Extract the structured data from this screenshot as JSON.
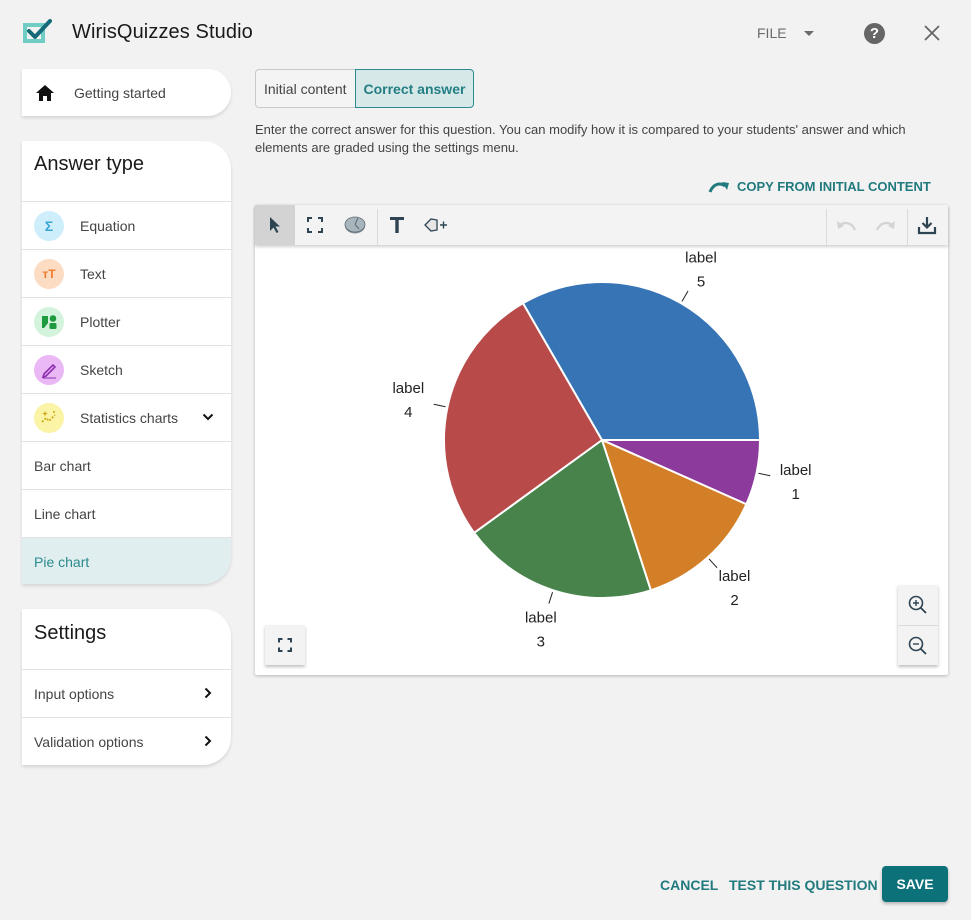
{
  "header": {
    "app_title": "WirisQuizzes Studio",
    "file_menu_label": "FILE",
    "help_icon": "question-circle-icon",
    "close_icon": "close-icon"
  },
  "sidebar": {
    "getting_started": {
      "label": "Getting started",
      "icon": "home-icon"
    },
    "answer_type": {
      "title": "Answer type",
      "items": [
        {
          "label": "Equation",
          "icon": "sigma-icon",
          "glyph": "Σ",
          "badge_bg": "#cdeefa",
          "badge_fg": "#3ba5d4"
        },
        {
          "label": "Text",
          "icon": "text-size-icon",
          "glyph": "тT",
          "badge_bg": "#fddcc4",
          "badge_fg": "#ee7b2a"
        },
        {
          "label": "Plotter",
          "icon": "shapes-icon",
          "glyph": "◆",
          "badge_bg": "#d4f3dc",
          "badge_fg": "#1f9a3f"
        },
        {
          "label": "Sketch",
          "icon": "pencil-icon",
          "glyph": "✎",
          "badge_bg": "#eab9f5",
          "badge_fg": "#8b2fb0"
        },
        {
          "label": "Statistics charts",
          "icon": "sparkle-chart-icon",
          "glyph": "✦",
          "badge_bg": "#fbf3a6",
          "badge_fg": "#c9a712",
          "expanded": true
        }
      ],
      "sub_items": [
        {
          "label": "Bar chart",
          "selected": false
        },
        {
          "label": "Line chart",
          "selected": false
        },
        {
          "label": "Pie chart",
          "selected": true
        }
      ]
    },
    "settings": {
      "title": "Settings",
      "items": [
        {
          "label": "Input options"
        },
        {
          "label": "Validation options"
        }
      ]
    }
  },
  "main": {
    "tabs": [
      {
        "label": "Initial content",
        "active": false
      },
      {
        "label": "Correct answer",
        "active": true
      }
    ],
    "description": "Enter the correct answer for this question. You can modify how it is compared to your students' answer and which elements are graded using the settings menu.",
    "copy_link": "COPY FROM INITIAL CONTENT",
    "toolbar": {
      "tools": [
        "select-arrow-icon",
        "selection-frame-icon",
        "pie-chart-icon",
        "text-tool-icon",
        "add-shape-icon"
      ],
      "right_tools": [
        "undo-icon",
        "redo-icon",
        "download-icon"
      ],
      "active_tool": "select-arrow-icon"
    }
  },
  "chart_data": {
    "type": "pie",
    "start_angle_deg": 0,
    "direction": "clockwise",
    "slices": [
      {
        "label": "label",
        "value": 1,
        "color": "#8c3b9c"
      },
      {
        "label": "label",
        "value": 2,
        "color": "#d27f27"
      },
      {
        "label": "label",
        "value": 3,
        "color": "#48834c"
      },
      {
        "label": "label",
        "value": 4,
        "color": "#b94a4a"
      },
      {
        "label": "label",
        "value": 5,
        "color": "#3674b6"
      }
    ]
  },
  "footer": {
    "cancel_label": "CANCEL",
    "test_label": "TEST THIS QUESTION",
    "save_label": "SAVE"
  },
  "colors": {
    "accent": "#217a7e",
    "save_bg": "#0d7179",
    "selected_row_bg": "#e0eeef"
  }
}
